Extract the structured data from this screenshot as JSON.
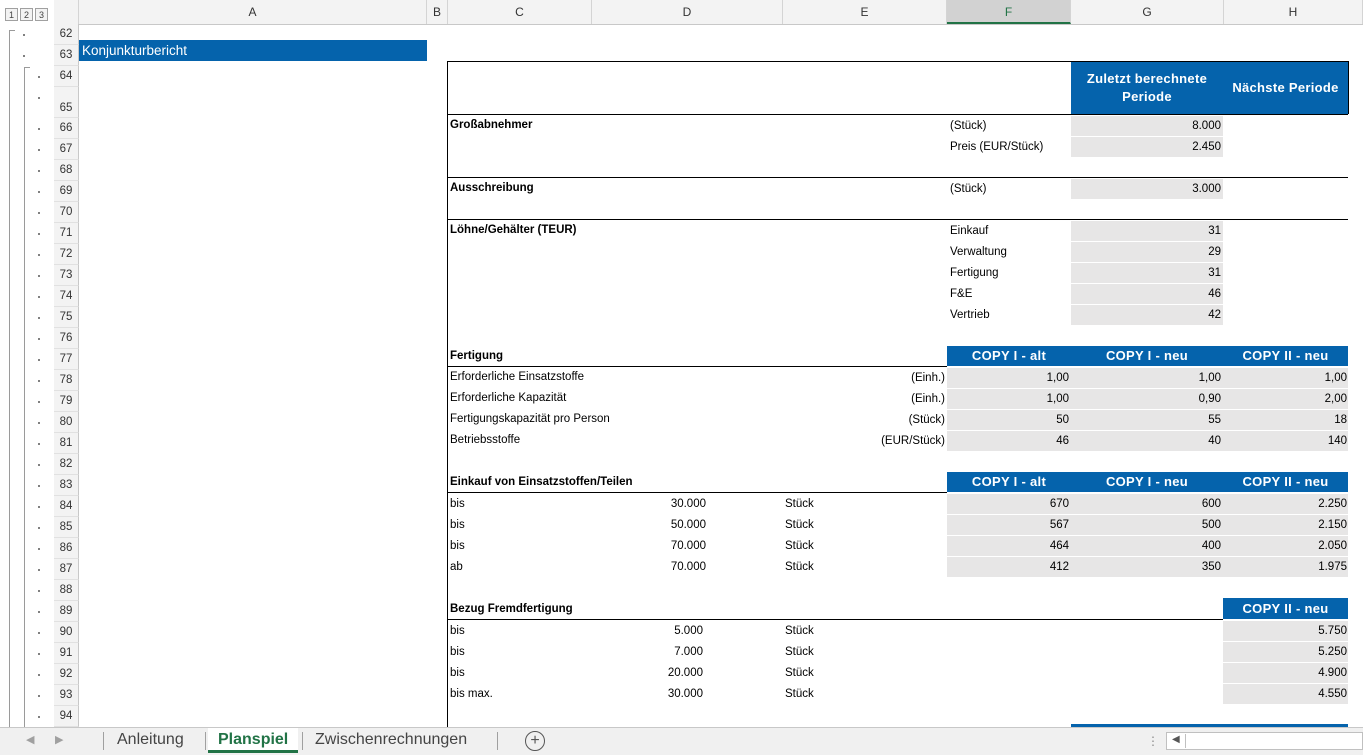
{
  "outline": {
    "levels": [
      "1",
      "2",
      "3"
    ]
  },
  "columns": [
    "A",
    "B",
    "C",
    "D",
    "E",
    "F",
    "G",
    "H"
  ],
  "rows": [
    "62",
    "63",
    "64",
    "65",
    "66",
    "67",
    "68",
    "69",
    "70",
    "71",
    "72",
    "73",
    "74",
    "75",
    "76",
    "77",
    "78",
    "79",
    "80",
    "81",
    "82",
    "83",
    "84",
    "85",
    "86",
    "87",
    "88",
    "89",
    "90",
    "91",
    "92",
    "93",
    "94"
  ],
  "title_cell": "Konjunkturbericht",
  "header": {
    "last_period": "Zuletzt berechnete Periode",
    "next_period": "Nächste Periode"
  },
  "grossabnehmer": {
    "label": "Großabnehmer",
    "unit1": "(Stück)",
    "val1": "8.000",
    "unit2": "Preis (EUR/Stück)",
    "val2": "2.450"
  },
  "ausschreibung": {
    "label": "Ausschreibung",
    "unit": "(Stück)",
    "val": "3.000"
  },
  "loehne": {
    "label": "Löhne/Gehälter (TEUR)",
    "items": [
      {
        "name": "Einkauf",
        "val": "31"
      },
      {
        "name": "Verwaltung",
        "val": "29"
      },
      {
        "name": "Fertigung",
        "val": "31"
      },
      {
        "name": "F&E",
        "val": "46"
      },
      {
        "name": "Vertrieb",
        "val": "42"
      }
    ]
  },
  "fertigung": {
    "label": "Fertigung",
    "cols": [
      "COPY I - alt",
      "COPY I - neu",
      "COPY II - neu"
    ],
    "rows": [
      {
        "name": "Erforderliche Einsatzstoffe",
        "unit": "(Einh.)",
        "v": [
          "1,00",
          "1,00",
          "1,00"
        ]
      },
      {
        "name": "Erforderliche Kapazität",
        "unit": "(Einh.)",
        "v": [
          "1,00",
          "0,90",
          "2,00"
        ]
      },
      {
        "name": "Fertigungskapazität pro Person",
        "unit": "(Stück)",
        "v": [
          "50",
          "55",
          "18"
        ]
      },
      {
        "name": "Betriebsstoffe",
        "unit": "(EUR/Stück)",
        "v": [
          "46",
          "40",
          "140"
        ]
      }
    ]
  },
  "einkauf": {
    "label": "Einkauf von Einsatzstoffen/Teilen",
    "cols": [
      "COPY I - alt",
      "COPY I - neu",
      "COPY II - neu"
    ],
    "rows": [
      {
        "k": "bis",
        "qty": "30.000",
        "unit": "Stück",
        "v": [
          "670",
          "600",
          "2.250"
        ]
      },
      {
        "k": "bis",
        "qty": "50.000",
        "unit": "Stück",
        "v": [
          "567",
          "500",
          "2.150"
        ]
      },
      {
        "k": "bis",
        "qty": "70.000",
        "unit": "Stück",
        "v": [
          "464",
          "400",
          "2.050"
        ]
      },
      {
        "k": "ab",
        "qty": "70.000",
        "unit": "Stück",
        "v": [
          "412",
          "350",
          "1.975"
        ]
      }
    ]
  },
  "fremd": {
    "label": "Bezug Fremdfertigung",
    "col": "COPY II - neu",
    "rows": [
      {
        "k": "bis",
        "qty": "5.000",
        "unit": "Stück",
        "v": "5.750"
      },
      {
        "k": "bis",
        "qty": "7.000",
        "unit": "Stück",
        "v": "5.250"
      },
      {
        "k": "bis",
        "qty": "20.000",
        "unit": "Stück",
        "v": "4.900"
      },
      {
        "k": "bis max.",
        "qty": "30.000",
        "unit": "Stück",
        "v": "4.550"
      }
    ]
  },
  "tabs": [
    "Anleitung",
    "Planspiel",
    "Zwischenrechnungen"
  ],
  "active_tab": "Planspiel"
}
